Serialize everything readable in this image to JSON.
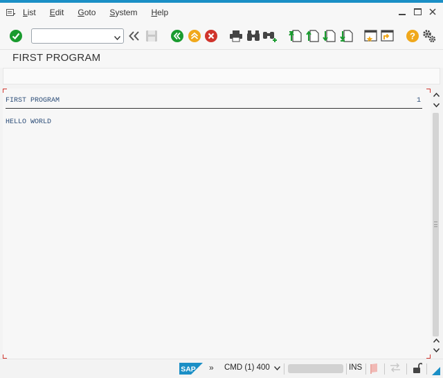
{
  "menu": {
    "items": [
      {
        "prefix": "",
        "underline": "L",
        "rest": "ist"
      },
      {
        "prefix": "",
        "underline": "E",
        "rest": "dit"
      },
      {
        "prefix": "",
        "underline": "G",
        "rest": "oto"
      },
      {
        "prefix": "",
        "underline": "S",
        "rest": "ystem"
      },
      {
        "prefix": "",
        "underline": "H",
        "rest": "elp"
      }
    ]
  },
  "toolbar": {
    "command_value": "",
    "icons": [
      "enter-icon",
      "back-icon",
      "save-icon",
      "back-green-icon",
      "exit-icon",
      "cancel-icon",
      "print-icon",
      "find-icon",
      "find-next-icon",
      "first-page-icon",
      "previous-page-icon",
      "next-page-icon",
      "last-page-icon",
      "new-session-icon",
      "shortcut-icon",
      "help-icon",
      "customize-layout-icon"
    ]
  },
  "page": {
    "title": "FIRST PROGRAM"
  },
  "list": {
    "header": "FIRST PROGRAM",
    "page_number": "1",
    "lines": [
      "HELLO WORLD"
    ]
  },
  "status": {
    "logo": "SAP",
    "nav": "»",
    "system": "CMD (1) 400",
    "mode": "INS"
  },
  "colors": {
    "accent_blue": "#1b8fc6",
    "ok_green": "#1a9b2f",
    "cancel_red": "#d0342c",
    "exit_yellow": "#f0a81c",
    "list_text": "#2c4d78"
  }
}
